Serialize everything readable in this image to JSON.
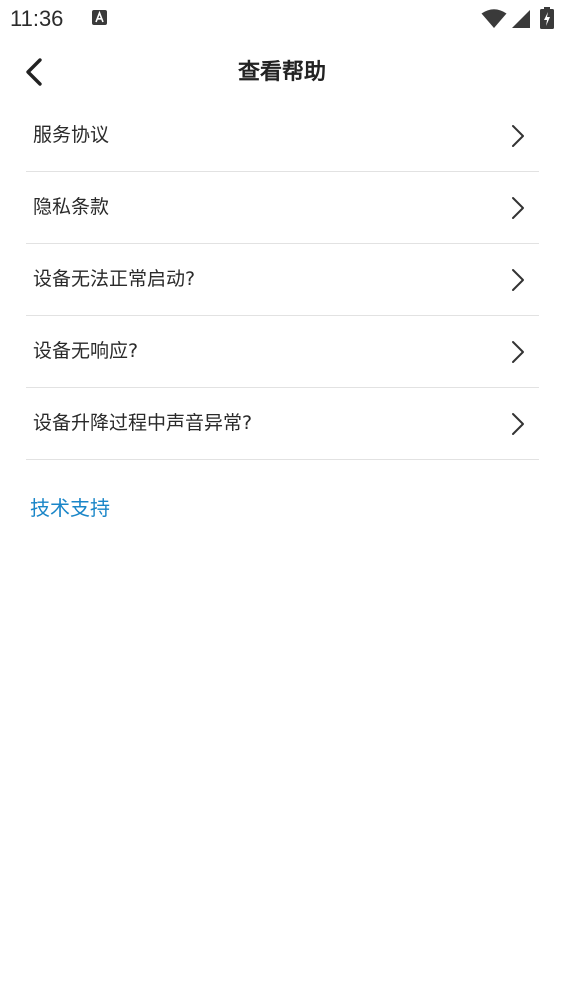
{
  "status_bar": {
    "time": "11:36",
    "icons": [
      "a-notification-icon",
      "wifi-icon",
      "signal-icon",
      "battery-icon"
    ]
  },
  "header": {
    "title": "查看帮助",
    "back_icon": "chevron-left-icon"
  },
  "help_items": [
    {
      "label": "服务协议"
    },
    {
      "label": "隐私条款"
    },
    {
      "label": "设备无法正常启动?"
    },
    {
      "label": "设备无响应?"
    },
    {
      "label": "设备升降过程中声音异常?"
    }
  ],
  "tech_support": {
    "label": "技术支持"
  },
  "colors": {
    "link": "#1a86c8",
    "divider": "#e2e2e2",
    "text": "#2a2a2a"
  }
}
